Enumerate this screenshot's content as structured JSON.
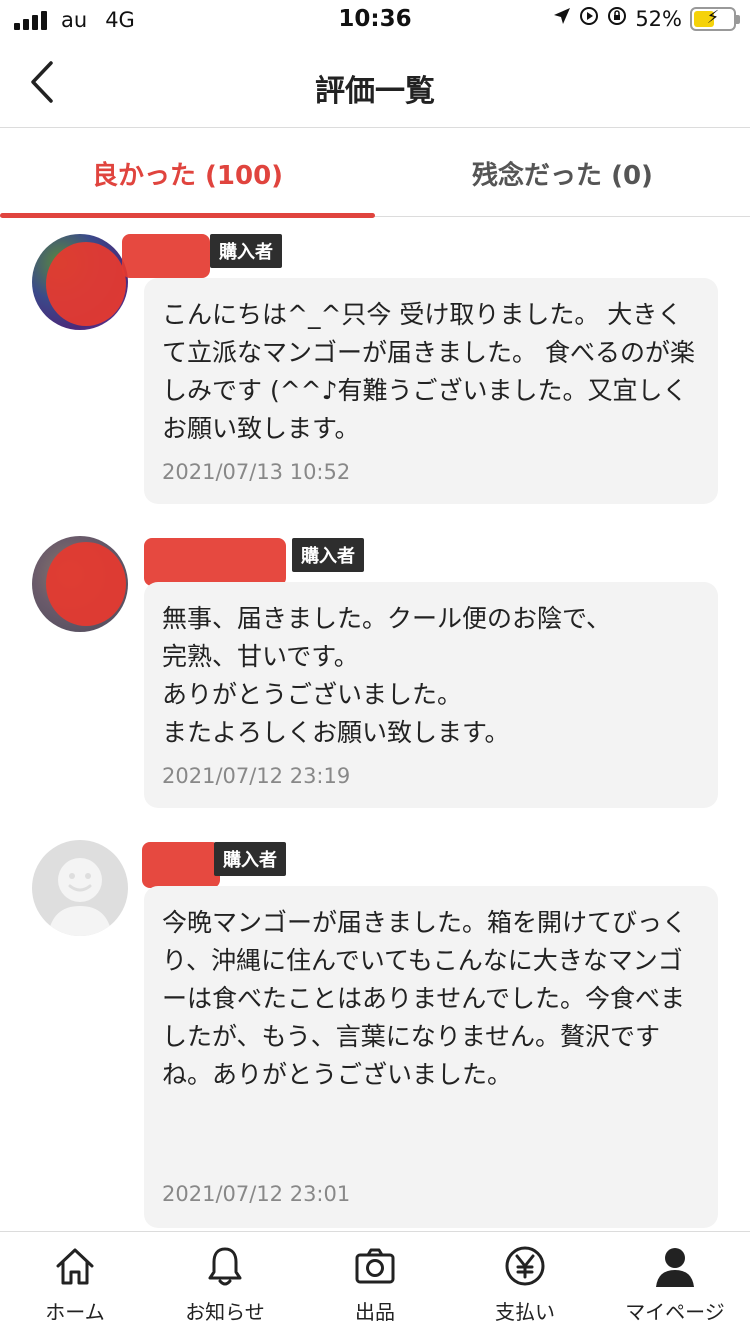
{
  "status_bar": {
    "carrier": "au",
    "network": "4G",
    "time": "10:36",
    "battery_percent": "52%",
    "battery_level": 0.52
  },
  "header": {
    "title": "評価一覧",
    "back_icon": "chevron-left-icon"
  },
  "tabs": [
    {
      "label": "良かった (100)",
      "active": true
    },
    {
      "label": "残念だった (0)",
      "active": false
    }
  ],
  "reviews": [
    {
      "badge": "購入者",
      "text": "こんにちは^_^只今 受け取りました。 大きくて立派なマンゴーが届きました。 食べるのが楽しみです (^^♪有難うございました。又宜しくお願い致します。",
      "date": "2021/07/13 10:52"
    },
    {
      "badge": "購入者",
      "text": "無事、届きました。クール便のお陰で、\n完熟、甘いです。\nありがとうございました。\nまたよろしくお願い致します。",
      "date": "2021/07/12 23:19"
    },
    {
      "badge": "購入者",
      "text": "今晩マンゴーが届きました。箱を開けてびっくり、沖縄に住んでいてもこんなに大きなマンゴーは食べたことはありませんでした。今食べましたが、もう、言葉になりません。贅沢ですね。ありがとうございました。",
      "date": "2021/07/12 23:01"
    }
  ],
  "bottom_nav": [
    {
      "label": "ホーム",
      "icon": "home-icon"
    },
    {
      "label": "お知らせ",
      "icon": "bell-icon"
    },
    {
      "label": "出品",
      "icon": "camera-icon"
    },
    {
      "label": "支払い",
      "icon": "yen-icon"
    },
    {
      "label": "マイページ",
      "icon": "person-icon"
    }
  ],
  "colors": {
    "accent": "#e0443e",
    "badge_bg": "#2e2e2e",
    "bubble_bg": "#f3f3f3"
  }
}
